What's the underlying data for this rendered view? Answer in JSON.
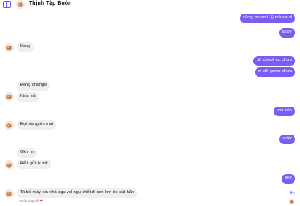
{
  "header": {
    "contact_name": "Thịnh Tập Buôn",
    "sidebar_icon": "sidebar-toggle-icon",
    "accent": "#7c4dff"
  },
  "messages": [
    {
      "side": "out",
      "text": "đừng scam t :)) mà sợ vl"
    },
    {
      "side": "out",
      "text": "sao r"
    },
    {
      "side": "in",
      "text": "Đang"
    },
    {
      "side": "out",
      "text": "dô check dc chưa"
    },
    {
      "side": "out",
      "text": "m dô game chưa"
    },
    {
      "side": "in",
      "text": "Đang change"
    },
    {
      "side": "in",
      "text": "Ktra mã"
    },
    {
      "side": "out",
      "text": "mã nào"
    },
    {
      "side": "in",
      "text": "Đợi đang ép mai"
    },
    {
      "side": "out",
      "text": "okkk"
    },
    {
      "side": "in",
      "text": "Ok r m"
    },
    {
      "side": "in",
      "text": "Để t gửi tk mk"
    },
    {
      "side": "out",
      "text": "oke"
    },
    {
      "side": "in",
      "text": "Tk bố mày xin nhá ngu vcl ngu chết đi con lợn óc cứt hãn"
    }
  ],
  "reaction": {
    "label": "Nhấn đúp để",
    "icon": "heart-icon"
  },
  "colors": {
    "outgoing": "#7b5cf5",
    "incoming": "#efefef"
  }
}
